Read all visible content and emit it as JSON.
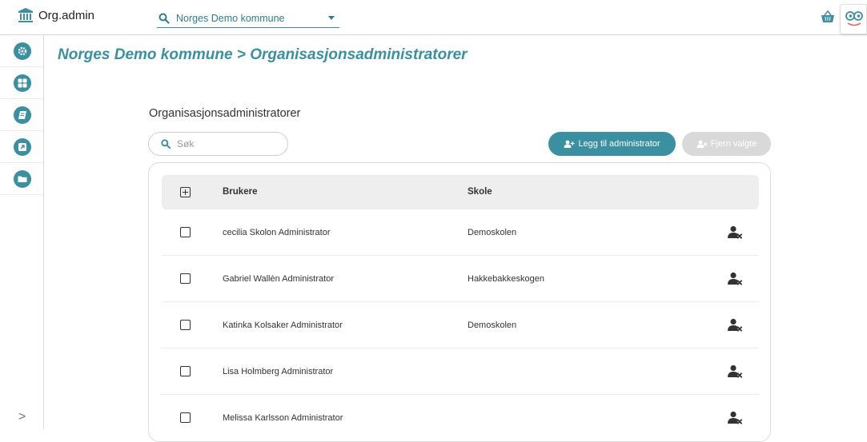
{
  "app": {
    "title": "Org.admin"
  },
  "org_selector": {
    "value": "Norges Demo kommune"
  },
  "breadcrumb": "Norges Demo kommune > Organisasjonsadministratorer",
  "section_title": "Organisasjonsadministratorer",
  "search": {
    "placeholder": "Søk"
  },
  "buttons": {
    "add": "Legg til administrator",
    "remove": "Fjern valgte"
  },
  "table": {
    "headers": {
      "users": "Brukere",
      "school": "Skole"
    },
    "rows": [
      {
        "name": "cecilia Skolon Administrator",
        "school": "Demoskolen"
      },
      {
        "name": "Gabriel Wallèn Administrator",
        "school": "Hakkebakkeskogen"
      },
      {
        "name": "Katinka Kolsaker Administrator",
        "school": "Demoskolen"
      },
      {
        "name": "Lisa Holmberg Administrator",
        "school": ""
      },
      {
        "name": "Melissa Karlsson Administrator",
        "school": ""
      }
    ]
  },
  "sidebar": {
    "items": [
      {
        "icon": "gear-icon"
      },
      {
        "icon": "grid-icon"
      },
      {
        "icon": "book-icon"
      },
      {
        "icon": "external-link-icon"
      },
      {
        "icon": "folder-icon"
      }
    ],
    "expand": ">"
  },
  "colors": {
    "accent": "#3a8fa0",
    "disabled": "#d9d9d9",
    "header_bg": "#eeeeee"
  }
}
